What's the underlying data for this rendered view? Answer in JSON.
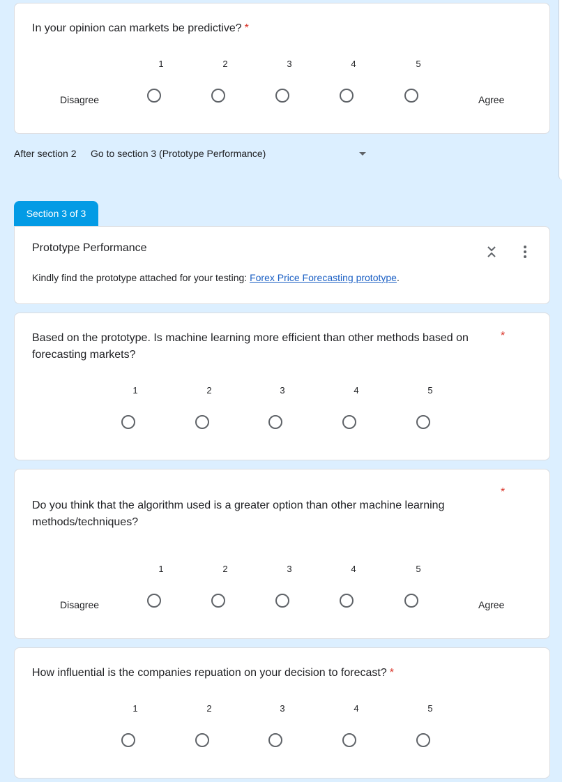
{
  "questions": [
    {
      "text": "In your opinion can markets be predictive?",
      "required_mark": "*",
      "scale": [
        "1",
        "2",
        "3",
        "4",
        "5"
      ],
      "low_label": "Disagree",
      "high_label": "Agree"
    },
    {
      "text": "Based on the prototype. Is machine learning more efficient than other methods based on forecasting markets?",
      "required_mark": "*",
      "scale": [
        "1",
        "2",
        "3",
        "4",
        "5"
      ]
    },
    {
      "text": "Do you think that the algorithm used is a greater option than other machine learning methods/techniques?",
      "required_mark": "*",
      "scale": [
        "1",
        "2",
        "3",
        "4",
        "5"
      ],
      "low_label": "Disagree",
      "high_label": "Agree"
    },
    {
      "text": "How influential is the companies repuation on your decision to forecast?",
      "required_mark": "*",
      "scale": [
        "1",
        "2",
        "3",
        "4",
        "5"
      ]
    }
  ],
  "navigation": {
    "after_label": "After section 2",
    "after_value": "Go to section 3 (Prototype Performance)"
  },
  "section": {
    "tab_label": "Section 3 of 3",
    "title": "Prototype Performance",
    "description_prefix": "Kindly find the prototype attached for your testing: ",
    "link_text": "Forex Price Forecasting prototype",
    "description_suffix": "."
  },
  "icons": {
    "collapse": "unfold-less-icon",
    "more": "more-vert-icon",
    "dropdown": "caret-down-icon"
  },
  "colors": {
    "background": "#dcefff",
    "accent": "#039be5",
    "required": "#d93025",
    "link": "#1a5fc4"
  }
}
